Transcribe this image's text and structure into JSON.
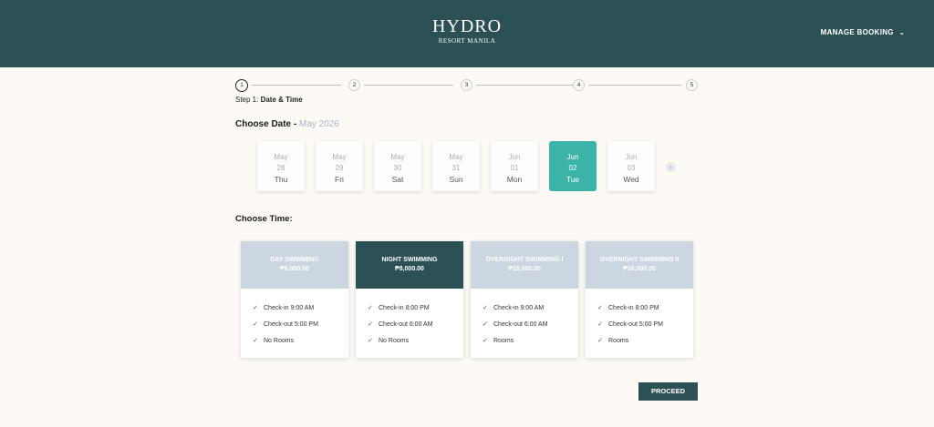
{
  "header": {
    "logo_main": "HYDRO",
    "logo_sub": "RESORT MANILA",
    "manage_booking": "MANAGE BOOKING",
    "chevron_glyph": "⌄"
  },
  "stepper": {
    "steps": [
      "1",
      "2",
      "3",
      "4",
      "5"
    ],
    "current_step": 1,
    "label_prefix": "Step 1: ",
    "label_name": "Date & Time"
  },
  "date_section": {
    "heading": "Choose Date -",
    "month": "May 2026",
    "dates": [
      {
        "month": "May",
        "day": "28",
        "weekday": "Thu",
        "selected": false
      },
      {
        "month": "May",
        "day": "29",
        "weekday": "Fri",
        "selected": false
      },
      {
        "month": "May",
        "day": "30",
        "weekday": "Sat",
        "selected": false
      },
      {
        "month": "May",
        "day": "31",
        "weekday": "Sun",
        "selected": false
      },
      {
        "month": "Jun",
        "day": "01",
        "weekday": "Mon",
        "selected": false
      },
      {
        "month": "Jun",
        "day": "02",
        "weekday": "Tue",
        "selected": true
      },
      {
        "month": "Jun",
        "day": "03",
        "weekday": "Wed",
        "selected": false
      }
    ],
    "next_glyph": "›"
  },
  "time_section": {
    "heading": "Choose Time:",
    "options": [
      {
        "name": "DAY SWIMMING",
        "price": "₱6,000.00",
        "selected": false,
        "features": [
          "Check-in 9:00 AM",
          "Check-out 5:00 PM",
          "No Rooms"
        ]
      },
      {
        "name": "NIGHT SWIMMING",
        "price": "₱8,000.00",
        "selected": true,
        "features": [
          "Check-in 8:00 PM",
          "Check-out 6:00 AM",
          "No Rooms"
        ]
      },
      {
        "name": "OVERNIGHT SWIMMING I",
        "price": "₱16,000.00",
        "selected": false,
        "features": [
          "Check-in 9:00 AM",
          "Check-out 6:00 AM",
          "Rooms"
        ]
      },
      {
        "name": "OVERNIGHT SWIMMING II",
        "price": "₱16,000.00",
        "selected": false,
        "features": [
          "Check-in 8:00 PM",
          "Check-out 5:00 PM",
          "Rooms"
        ]
      }
    ],
    "check_glyph": "✓"
  },
  "actions": {
    "proceed_label": "PROCEED"
  },
  "colors": {
    "header_bg": "#2c5155",
    "accent_teal": "#3bb3a6",
    "card_head_inactive": "#cbd6e1",
    "page_bg": "#fdfaf6"
  }
}
